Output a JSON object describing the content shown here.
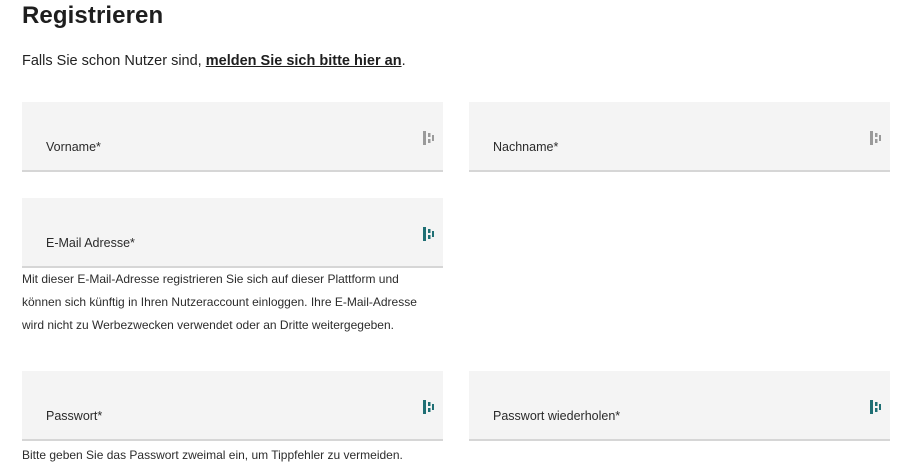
{
  "page": {
    "title": "Registrieren",
    "intro_text": "Falls Sie schon Nutzer sind, ",
    "login_link": "melden Sie sich bitte hier an",
    "intro_suffix": "."
  },
  "fields": {
    "first_name": {
      "label": "Vorname*",
      "value": ""
    },
    "last_name": {
      "label": "Nachname*",
      "value": ""
    },
    "email": {
      "label": "E-Mail Adresse*",
      "value": ""
    },
    "password": {
      "label": "Passwort*",
      "value": ""
    },
    "password_repeat": {
      "label": "Passwort wiederholen*",
      "value": ""
    }
  },
  "help": {
    "email_line1": "Mit dieser E-Mail-Adresse registrieren Sie sich auf dieser Plattform und",
    "email_line2": "können sich künftig in Ihren Nutzeraccount einloggen. Ihre E-Mail-Adresse",
    "email_line3": "wird nicht zu Werbezwecken verwendet oder an Dritte weitergegeben.",
    "password": "Bitte geben Sie das Passwort zweimal ein, um Tippfehler zu vermeiden."
  },
  "icons": {
    "password_manager": "password-manager-icon",
    "inactive_color": "#9a9a9a",
    "active_color": "#1f6f74"
  }
}
